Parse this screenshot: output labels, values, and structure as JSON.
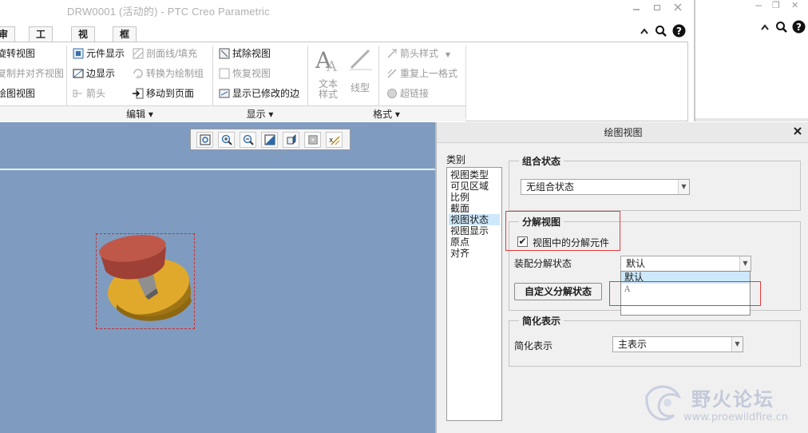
{
  "window": {
    "title": "DRW0001 (活动的) - PTC Creo Parametric",
    "minimize_icon": "minimize-icon",
    "restore_icon": "restore-icon",
    "close_icon": "close-icon",
    "second_minimize": "−",
    "second_restore": "❐",
    "second_close": "✕"
  },
  "tabs": [
    {
      "label": "审阅"
    },
    {
      "label": "工具"
    },
    {
      "label": "视图"
    },
    {
      "label": "框架"
    }
  ],
  "ribbon": {
    "col1": [
      {
        "label": "旋转视图",
        "disabled": false
      },
      {
        "label": "复制并对齐视图",
        "disabled": true
      },
      {
        "label": "绘图视图",
        "disabled": false
      }
    ],
    "col2": [
      {
        "label": "元件显示",
        "disabled": false
      },
      {
        "label": "边显示",
        "disabled": false
      },
      {
        "label": "箭头",
        "disabled": true
      }
    ],
    "col3": [
      {
        "label": "剖面线/填充",
        "disabled": true
      },
      {
        "label": "转换为绘制组",
        "disabled": true
      },
      {
        "label": "移动到页面",
        "disabled": false
      }
    ],
    "col4": [
      {
        "label": "拭除视图",
        "disabled": false
      },
      {
        "label": "恢复视图",
        "disabled": true
      },
      {
        "label": "显示已修改的边",
        "disabled": false
      }
    ],
    "format_big": [
      {
        "label": "文本样式"
      },
      {
        "label": "线型"
      }
    ],
    "col5": [
      {
        "label": "箭头样式",
        "disabled": true
      },
      {
        "label": "重复上一格式",
        "disabled": true
      },
      {
        "label": "超链接",
        "disabled": true
      }
    ],
    "groups": [
      {
        "label": "编辑 ▾"
      },
      {
        "label": "显示 ▾"
      },
      {
        "label": "格式 ▾"
      }
    ]
  },
  "view_toolbar": {
    "tools": [
      "zoom-fit-icon",
      "zoom-in-icon",
      "zoom-out-icon",
      "repaint-icon",
      "display-style-icon",
      "saved-orientations-icon",
      "annotation-display-icon"
    ]
  },
  "dialog": {
    "title": "绘图视图",
    "category_label": "类别",
    "categories": [
      {
        "label": "视图类型",
        "selected": false
      },
      {
        "label": "可见区域",
        "selected": false
      },
      {
        "label": "比例",
        "selected": false
      },
      {
        "label": "截面",
        "selected": false
      },
      {
        "label": "视图状态",
        "selected": true
      },
      {
        "label": "视图显示",
        "selected": false
      },
      {
        "label": "原点",
        "selected": false
      },
      {
        "label": "对齐",
        "selected": false
      }
    ],
    "combined_state": {
      "legend": "组合状态",
      "value": "无组合状态"
    },
    "explode": {
      "legend": "分解视图",
      "checkbox_label": "视图中的分解元件",
      "checked": true,
      "state_label": "装配分解状态",
      "state_value": "默认",
      "options": [
        "默认",
        "A"
      ],
      "custom_button": "自定义分解状态"
    },
    "simplified": {
      "legend": "简化表示",
      "label": "简化表示",
      "value": "主表示"
    }
  },
  "watermark": {
    "text": "野火论坛",
    "url": "www.proewildfire.cn"
  },
  "colors": {
    "canvas_bg": "#7f9cc0",
    "selection_bg": "#cde8fb",
    "highlight_red": "#e03c3c",
    "model_top": "#c0584a",
    "model_base": "#e0a92c"
  }
}
